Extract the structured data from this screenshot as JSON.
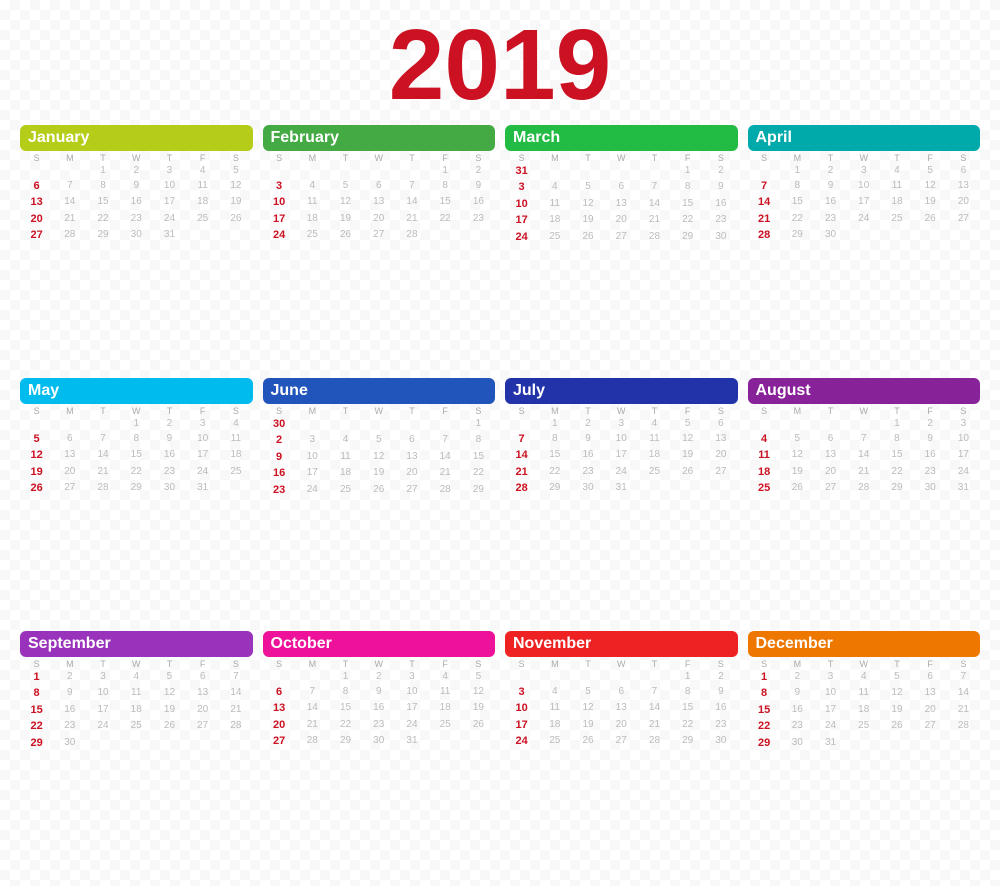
{
  "year": "2019",
  "months": [
    {
      "name": "January",
      "color": "#b5cc18",
      "days_of_week": [
        "S",
        "M",
        "T",
        "W",
        "T",
        "F",
        "S"
      ],
      "weeks": [
        [
          "",
          "",
          "1",
          "2",
          "3",
          "4",
          "5"
        ],
        [
          "6",
          "7",
          "8",
          "9",
          "10",
          "11",
          "12"
        ],
        [
          "13",
          "14",
          "15",
          "16",
          "17",
          "18",
          "19"
        ],
        [
          "20",
          "21",
          "22",
          "23",
          "24",
          "25",
          "26"
        ],
        [
          "27",
          "28",
          "29",
          "30",
          "31",
          "",
          ""
        ]
      ],
      "sundays": [
        6,
        13,
        20,
        27
      ]
    },
    {
      "name": "February",
      "color": "#44aa44",
      "days_of_week": [
        "S",
        "M",
        "T",
        "W",
        "T",
        "F",
        "S"
      ],
      "weeks": [
        [
          "",
          "",
          "",
          "",
          "",
          "1",
          "2"
        ],
        [
          "3",
          "4",
          "5",
          "6",
          "7",
          "8",
          "9"
        ],
        [
          "10",
          "11",
          "12",
          "13",
          "14",
          "15",
          "16"
        ],
        [
          "17",
          "18",
          "19",
          "20",
          "21",
          "22",
          "23"
        ],
        [
          "24",
          "25",
          "26",
          "27",
          "28",
          "",
          ""
        ]
      ],
      "sundays": [
        3,
        10,
        17,
        24
      ]
    },
    {
      "name": "March",
      "color": "#22bb44",
      "days_of_week": [
        "S",
        "M",
        "T",
        "W",
        "T",
        "F",
        "S"
      ],
      "weeks": [
        [
          "31",
          "",
          "",
          "",
          "",
          "1",
          "2"
        ],
        [
          "3",
          "4",
          "5",
          "6",
          "7",
          "8",
          "9"
        ],
        [
          "10",
          "11",
          "12",
          "13",
          "14",
          "15",
          "16"
        ],
        [
          "17",
          "18",
          "19",
          "20",
          "21",
          "22",
          "23"
        ],
        [
          "24",
          "25",
          "26",
          "27",
          "28",
          "29",
          "30"
        ]
      ],
      "sundays": [
        3,
        10,
        17,
        24,
        31
      ]
    },
    {
      "name": "April",
      "color": "#00aaaa",
      "days_of_week": [
        "S",
        "M",
        "T",
        "W",
        "T",
        "F",
        "S"
      ],
      "weeks": [
        [
          "",
          "1",
          "2",
          "3",
          "4",
          "5",
          "6"
        ],
        [
          "7",
          "8",
          "9",
          "10",
          "11",
          "12",
          "13"
        ],
        [
          "14",
          "15",
          "16",
          "17",
          "18",
          "19",
          "20"
        ],
        [
          "21",
          "22",
          "23",
          "24",
          "25",
          "26",
          "27"
        ],
        [
          "28",
          "29",
          "30",
          "",
          "",
          "",
          ""
        ]
      ],
      "sundays": [
        7,
        14,
        21,
        28
      ]
    },
    {
      "name": "May",
      "color": "#00bbee",
      "days_of_week": [
        "S",
        "M",
        "T",
        "W",
        "T",
        "F",
        "S"
      ],
      "weeks": [
        [
          "",
          "",
          "",
          "1",
          "2",
          "3",
          "4"
        ],
        [
          "5",
          "6",
          "7",
          "8",
          "9",
          "10",
          "11"
        ],
        [
          "12",
          "13",
          "14",
          "15",
          "16",
          "17",
          "18"
        ],
        [
          "19",
          "20",
          "21",
          "22",
          "23",
          "24",
          "25"
        ],
        [
          "26",
          "27",
          "28",
          "29",
          "30",
          "31",
          ""
        ]
      ],
      "sundays": [
        5,
        12,
        19,
        26
      ]
    },
    {
      "name": "June",
      "color": "#2255bb",
      "days_of_week": [
        "S",
        "M",
        "T",
        "W",
        "T",
        "F",
        "S"
      ],
      "weeks": [
        [
          "30",
          "",
          "",
          "",
          "",
          "",
          "1"
        ],
        [
          "2",
          "3",
          "4",
          "5",
          "6",
          "7",
          "8"
        ],
        [
          "9",
          "10",
          "11",
          "12",
          "13",
          "14",
          "15"
        ],
        [
          "16",
          "17",
          "18",
          "19",
          "20",
          "21",
          "22"
        ],
        [
          "23",
          "24",
          "25",
          "26",
          "27",
          "28",
          "29"
        ]
      ],
      "sundays": [
        2,
        9,
        16,
        23,
        30
      ]
    },
    {
      "name": "July",
      "color": "#2233aa",
      "days_of_week": [
        "S",
        "M",
        "T",
        "W",
        "T",
        "F",
        "S"
      ],
      "weeks": [
        [
          "",
          "1",
          "2",
          "3",
          "4",
          "5",
          "6"
        ],
        [
          "7",
          "8",
          "9",
          "10",
          "11",
          "12",
          "13"
        ],
        [
          "14",
          "15",
          "16",
          "17",
          "18",
          "19",
          "20"
        ],
        [
          "21",
          "22",
          "23",
          "24",
          "25",
          "26",
          "27"
        ],
        [
          "28",
          "29",
          "30",
          "31",
          "",
          "",
          ""
        ]
      ],
      "sundays": [
        7,
        14,
        21,
        28
      ]
    },
    {
      "name": "August",
      "color": "#882299",
      "days_of_week": [
        "S",
        "M",
        "T",
        "W",
        "T",
        "F",
        "S"
      ],
      "weeks": [
        [
          "",
          "",
          "",
          "",
          "1",
          "2",
          "3"
        ],
        [
          "4",
          "5",
          "6",
          "7",
          "8",
          "9",
          "10"
        ],
        [
          "11",
          "12",
          "13",
          "14",
          "15",
          "16",
          "17"
        ],
        [
          "18",
          "19",
          "20",
          "21",
          "22",
          "23",
          "24"
        ],
        [
          "25",
          "26",
          "27",
          "28",
          "29",
          "30",
          "31"
        ]
      ],
      "sundays": [
        4,
        11,
        18,
        25
      ]
    },
    {
      "name": "September",
      "color": "#9933bb",
      "days_of_week": [
        "S",
        "M",
        "T",
        "W",
        "T",
        "F",
        "S"
      ],
      "weeks": [
        [
          "1",
          "2",
          "3",
          "4",
          "5",
          "6",
          "7"
        ],
        [
          "8",
          "9",
          "10",
          "11",
          "12",
          "13",
          "14"
        ],
        [
          "15",
          "16",
          "17",
          "18",
          "19",
          "20",
          "21"
        ],
        [
          "22",
          "23",
          "24",
          "25",
          "26",
          "27",
          "28"
        ],
        [
          "29",
          "30",
          "",
          "",
          "",
          "",
          ""
        ]
      ],
      "sundays": [
        1,
        8,
        15,
        22,
        29
      ]
    },
    {
      "name": "October",
      "color": "#ee1199",
      "days_of_week": [
        "S",
        "M",
        "T",
        "W",
        "T",
        "F",
        "S"
      ],
      "weeks": [
        [
          "",
          "",
          "1",
          "2",
          "3",
          "4",
          "5"
        ],
        [
          "6",
          "7",
          "8",
          "9",
          "10",
          "11",
          "12"
        ],
        [
          "13",
          "14",
          "15",
          "16",
          "17",
          "18",
          "19"
        ],
        [
          "20",
          "21",
          "22",
          "23",
          "24",
          "25",
          "26"
        ],
        [
          "27",
          "28",
          "29",
          "30",
          "31",
          "",
          ""
        ]
      ],
      "sundays": [
        6,
        13,
        20,
        27
      ]
    },
    {
      "name": "November",
      "color": "#ee2222",
      "days_of_week": [
        "S",
        "M",
        "T",
        "W",
        "T",
        "F",
        "S"
      ],
      "weeks": [
        [
          "",
          "",
          "",
          "",
          "",
          "1",
          "2"
        ],
        [
          "3",
          "4",
          "5",
          "6",
          "7",
          "8",
          "9"
        ],
        [
          "10",
          "11",
          "12",
          "13",
          "14",
          "15",
          "16"
        ],
        [
          "17",
          "18",
          "19",
          "20",
          "21",
          "22",
          "23"
        ],
        [
          "24",
          "25",
          "26",
          "27",
          "28",
          "29",
          "30"
        ]
      ],
      "sundays": [
        3,
        10,
        17,
        24
      ]
    },
    {
      "name": "December",
      "color": "#ee7700",
      "days_of_week": [
        "S",
        "M",
        "T",
        "W",
        "T",
        "F",
        "S"
      ],
      "weeks": [
        [
          "1",
          "2",
          "3",
          "4",
          "5",
          "6",
          "7"
        ],
        [
          "8",
          "9",
          "10",
          "11",
          "12",
          "13",
          "14"
        ],
        [
          "15",
          "16",
          "17",
          "18",
          "19",
          "20",
          "21"
        ],
        [
          "22",
          "23",
          "24",
          "25",
          "26",
          "27",
          "28"
        ],
        [
          "29",
          "30",
          "31",
          "",
          "",
          "",
          ""
        ]
      ],
      "sundays": [
        1,
        8,
        15,
        22,
        29
      ]
    }
  ]
}
